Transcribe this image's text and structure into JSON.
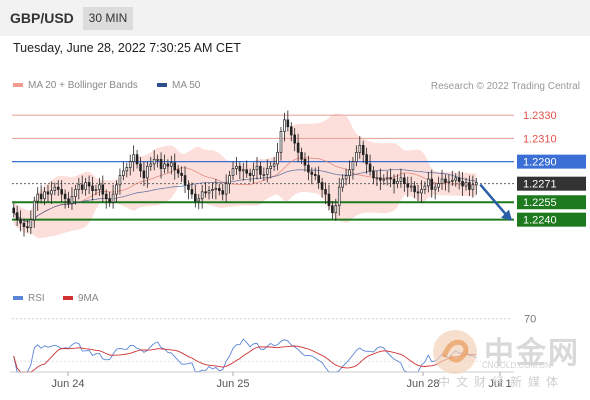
{
  "header": {
    "symbol": "GBP/USD",
    "timeframe": "30 MIN"
  },
  "timestamp": "Tuesday, June 28, 2022 7:30:25 AM CET",
  "legend": {
    "ma20": "MA 20 + Bollinger Bands",
    "ma50": "MA 50",
    "rsi": "RSI",
    "ma9": "9MA",
    "credit": "Research © 2022 Trading Central"
  },
  "colors": {
    "resistance": "#e8a79f",
    "pivot": "#3b6fd6",
    "support": "#1e7a1e",
    "band": "#fbd9d5",
    "ma20": "#e07a6a",
    "ma50": "#2d4f8c",
    "rsi": "#5b86d6",
    "rsi_ma": "#d03030",
    "candle": "#222222",
    "arrow": "#2a5ea8"
  },
  "watermark": {
    "name": "中金网",
    "url": "CNGOLD.COM.CN",
    "tagline": "中文财经新媒体"
  },
  "chart_data": [
    {
      "type": "candlestick",
      "y_range": [
        1.2188,
        1.235
      ],
      "grid": false,
      "x_ticks": [
        "Jun 24",
        "Jun 25",
        "Jun 28",
        "Jul 1"
      ],
      "levels": [
        {
          "value": 1.233,
          "label": "1.2330",
          "kind": "resistance"
        },
        {
          "value": 1.231,
          "label": "1.2310",
          "kind": "resistance"
        },
        {
          "value": 1.229,
          "label": "1.2290",
          "kind": "pivot"
        },
        {
          "value": 1.2271,
          "label": "1.2271",
          "kind": "current"
        },
        {
          "value": 1.2255,
          "label": "1.2255",
          "kind": "support"
        },
        {
          "value": 1.224,
          "label": "1.2240",
          "kind": "support"
        }
      ],
      "forecast": {
        "from": 1.2272,
        "to": 1.224,
        "direction": "down"
      },
      "closes": [
        1.2246,
        1.224,
        1.2237,
        1.2234,
        1.2233,
        1.224,
        1.2256,
        1.2262,
        1.2258,
        1.2264,
        1.2262,
        1.2265,
        1.2268,
        1.2266,
        1.2262,
        1.2258,
        1.2254,
        1.226,
        1.2266,
        1.227,
        1.2266,
        1.2272,
        1.2269,
        1.2265,
        1.2266,
        1.227,
        1.2262,
        1.2258,
        1.2255,
        1.2262,
        1.227,
        1.2278,
        1.2282,
        1.2285,
        1.229,
        1.2296,
        1.2288,
        1.2282,
        1.2276,
        1.2286,
        1.2288,
        1.2292,
        1.2292,
        1.2284,
        1.2288,
        1.2286,
        1.2289,
        1.2283,
        1.228,
        1.2278,
        1.227,
        1.2266,
        1.2262,
        1.2256,
        1.2258,
        1.2264,
        1.2263,
        1.2265,
        1.2266,
        1.2267,
        1.2265,
        1.2262,
        1.2271,
        1.2278,
        1.2284,
        1.2286,
        1.2282,
        1.2283,
        1.228,
        1.2278,
        1.2283,
        1.2286,
        1.2279,
        1.2279,
        1.2284,
        1.2286,
        1.2288,
        1.2298,
        1.2316,
        1.2326,
        1.232,
        1.2313,
        1.2306,
        1.2298,
        1.2292,
        1.2287,
        1.2281,
        1.2279,
        1.2278,
        1.2272,
        1.2266,
        1.2262,
        1.2252,
        1.2246,
        1.2252,
        1.2268,
        1.2275,
        1.2278,
        1.2283,
        1.229,
        1.2298,
        1.2304,
        1.2296,
        1.2288,
        1.2282,
        1.2276,
        1.2276,
        1.2274,
        1.2275,
        1.2276,
        1.2275,
        1.2271,
        1.2273,
        1.2276,
        1.2271,
        1.2268,
        1.2269,
        1.2264,
        1.2263,
        1.2266,
        1.2269,
        1.2275,
        1.2266,
        1.2268,
        1.2271,
        1.2275,
        1.2272,
        1.2273,
        1.2274,
        1.2276,
        1.2273,
        1.2269,
        1.2272,
        1.2266,
        1.227,
        1.2272
      ]
    },
    {
      "type": "line",
      "name": "RSI",
      "y_range": [
        20,
        80
      ],
      "levels": [
        {
          "value": 70,
          "label": "70"
        }
      ],
      "x_ticks": [
        "Jun 24",
        "Jun 25",
        "Jun 28",
        "Jul 1"
      ]
    }
  ]
}
